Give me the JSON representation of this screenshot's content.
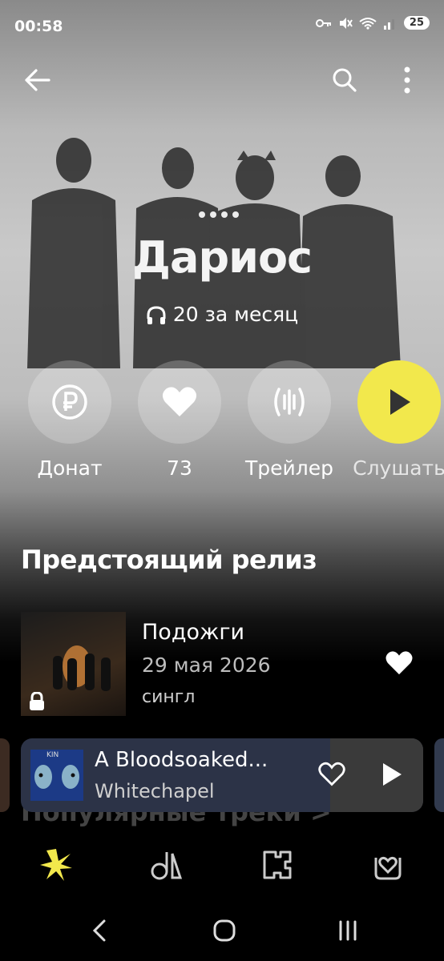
{
  "status_bar": {
    "time": "00:58",
    "battery": "25"
  },
  "artist": {
    "name": "Дариос",
    "listeners": "20 за месяц"
  },
  "actions": [
    {
      "label": "Донат",
      "icon": "ruble-icon"
    },
    {
      "label": "73",
      "icon": "heart-icon"
    },
    {
      "label": "Трейлер",
      "icon": "waveform-icon"
    },
    {
      "label": "Слушать",
      "icon": "play-icon"
    }
  ],
  "upcoming": {
    "section_title": "Предстоящий релиз",
    "title": "Подожги",
    "date": "29 мая 2026",
    "type": "сингл"
  },
  "popular": {
    "section_title": "Популярные треки >"
  },
  "mini_player": {
    "title": "A Bloodsoaked...",
    "artist": "Whitechapel",
    "cover_text": "KIN"
  },
  "colors": {
    "accent": "#f2e84c",
    "player_bg": "#2c3347"
  }
}
